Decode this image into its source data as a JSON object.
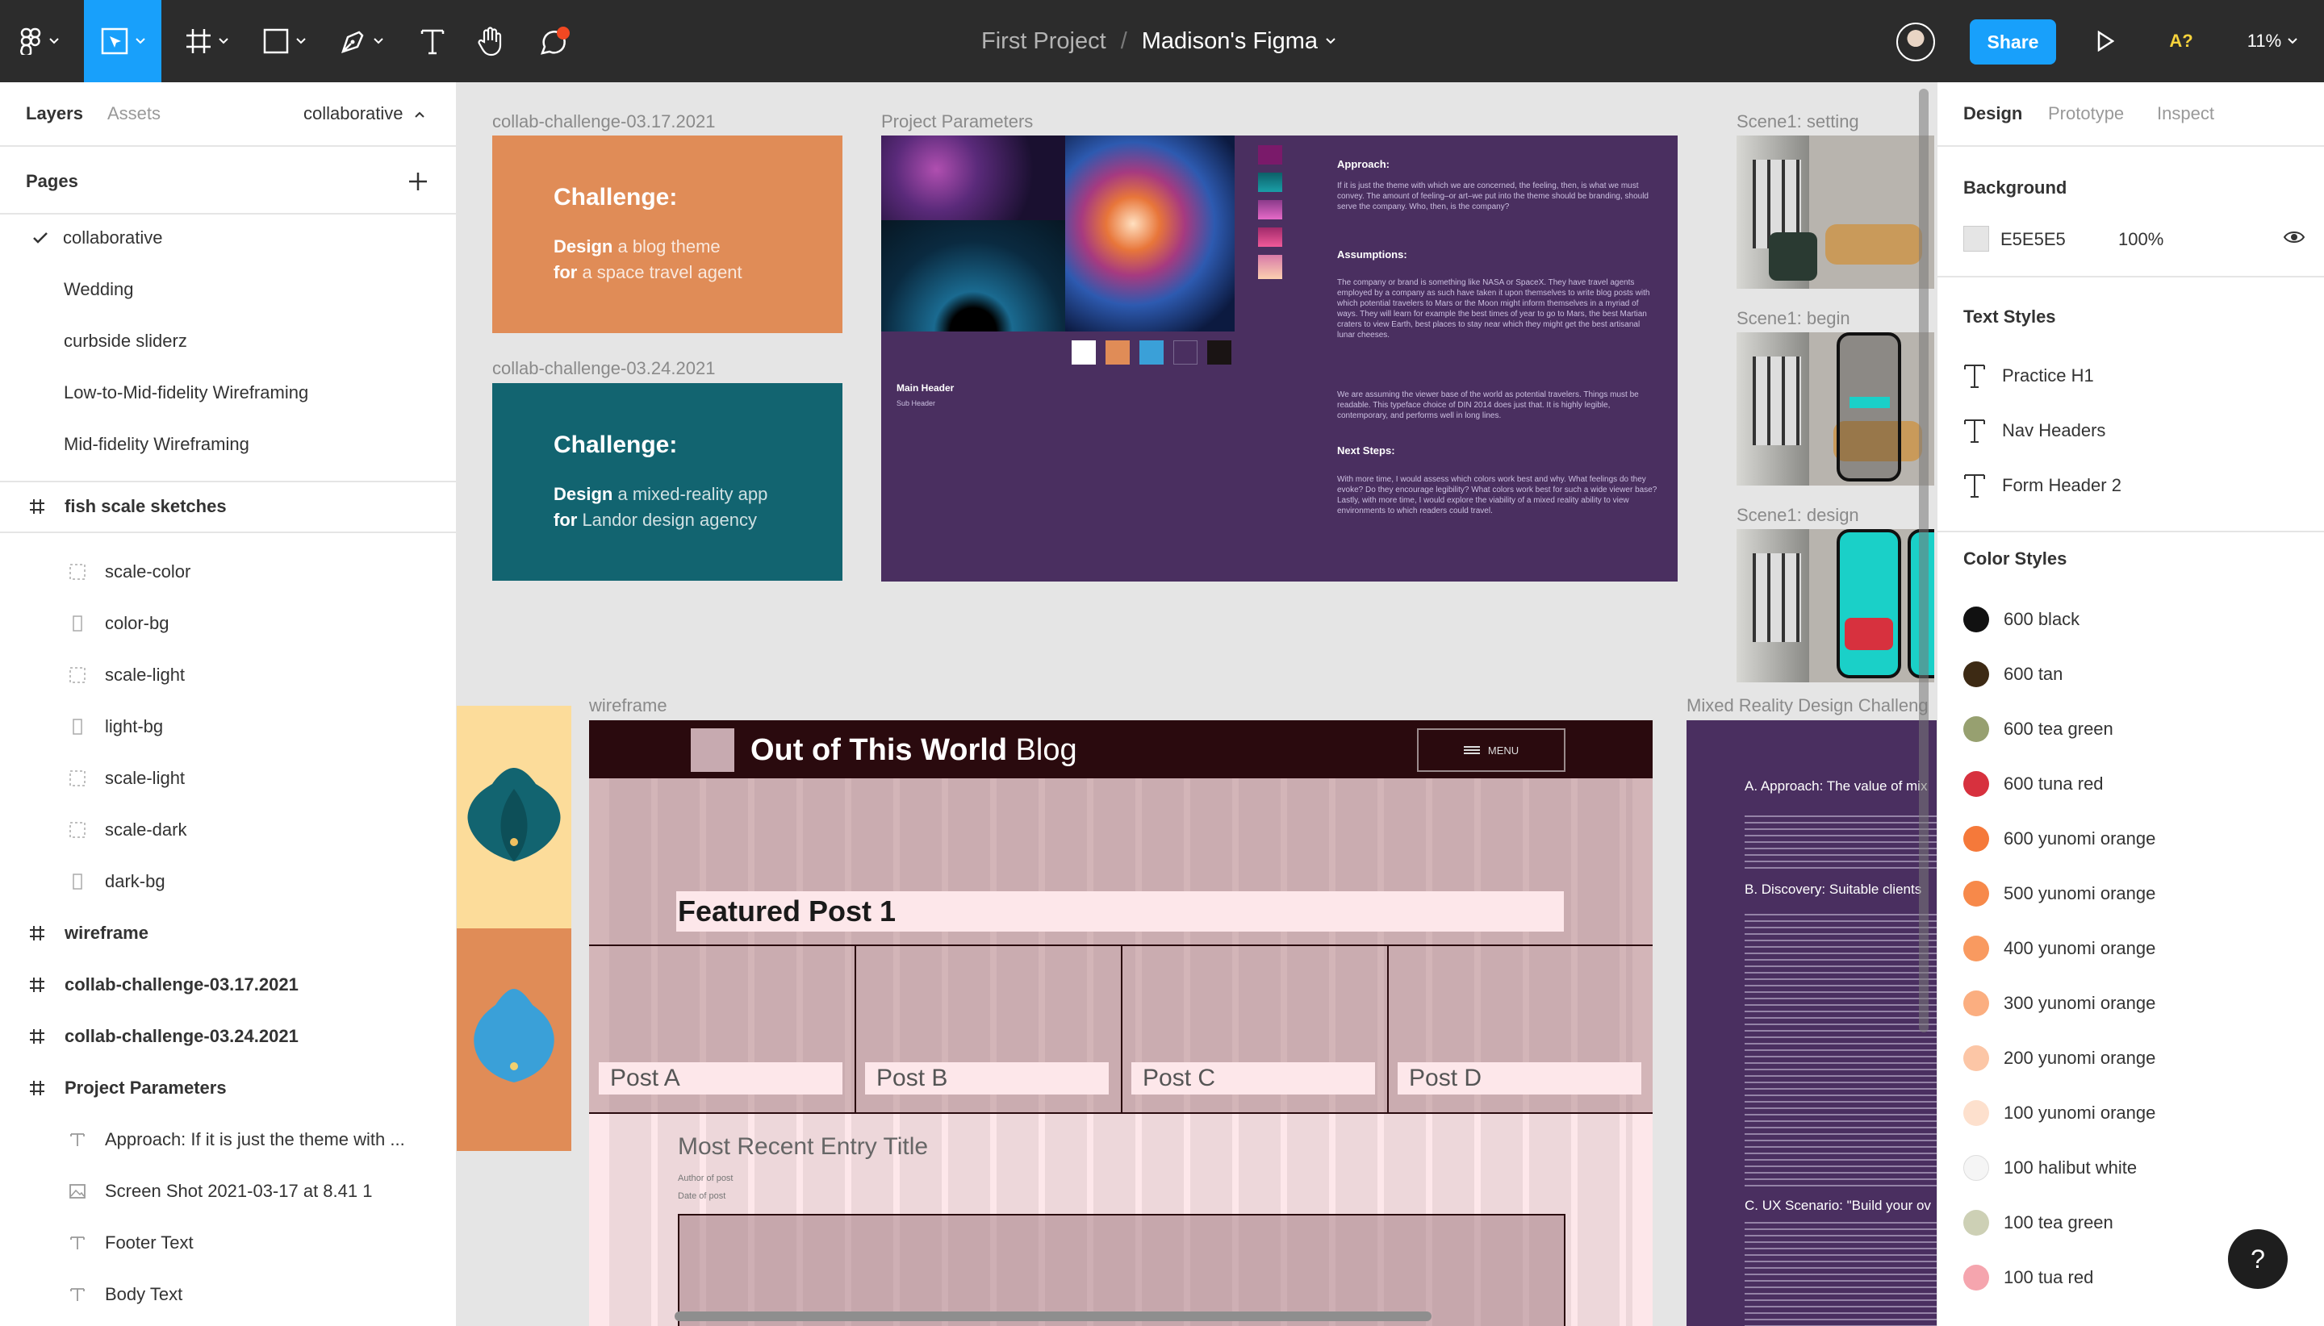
{
  "toolbar": {
    "project": "First Project",
    "separator": "/",
    "file_name": "Madison's Figma",
    "share_label": "Share",
    "user_initials": "A?",
    "zoom": "11%",
    "notification_color": "#f24822",
    "active_tool_color": "#18a0fb"
  },
  "left_panel": {
    "tabs": {
      "layers": "Layers",
      "assets": "Assets"
    },
    "current_page": "collaborative",
    "pages_title": "Pages",
    "pages": [
      {
        "label": "collaborative",
        "checked": true
      },
      {
        "label": "Wedding"
      },
      {
        "label": "curbside sliderz"
      },
      {
        "label": "Low-to-Mid-fidelity Wireframing"
      },
      {
        "label": "Mid-fidelity Wireframing"
      }
    ],
    "layers": [
      {
        "label": "fish scale sketches",
        "type": "frame",
        "bold": true
      },
      {
        "label": "scale-color",
        "type": "component"
      },
      {
        "label": "color-bg",
        "type": "rect"
      },
      {
        "label": "scale-light",
        "type": "component"
      },
      {
        "label": "light-bg",
        "type": "rect"
      },
      {
        "label": "scale-light",
        "type": "component"
      },
      {
        "label": "scale-dark",
        "type": "component"
      },
      {
        "label": "dark-bg",
        "type": "rect"
      },
      {
        "label": "wireframe",
        "type": "frame",
        "bold": true
      },
      {
        "label": "collab-challenge-03.17.2021",
        "type": "frame",
        "bold": true
      },
      {
        "label": "collab-challenge-03.24.2021",
        "type": "frame",
        "bold": true
      },
      {
        "label": "Project Parameters",
        "type": "frame",
        "bold": true
      },
      {
        "label": "Approach: If it is just the theme with ...",
        "type": "text"
      },
      {
        "label": "Screen Shot 2021-03-17 at 8.41 1",
        "type": "image"
      },
      {
        "label": "Footer Text",
        "type": "text"
      },
      {
        "label": "Body Text",
        "type": "text"
      }
    ]
  },
  "right_panel": {
    "tabs": {
      "design": "Design",
      "prototype": "Prototype",
      "inspect": "Inspect"
    },
    "background_title": "Background",
    "background_hex": "E5E5E5",
    "background_opacity": "100%",
    "text_styles_title": "Text Styles",
    "text_styles": [
      "Practice H1",
      "Nav Headers",
      "Form Header 2"
    ],
    "color_styles_title": "Color Styles",
    "color_styles": [
      {
        "name": "600 black",
        "color": "#111111"
      },
      {
        "name": "600 tan",
        "color": "#3d2a14"
      },
      {
        "name": "600 tea green",
        "color": "#97a070"
      },
      {
        "name": "600 tuna red",
        "color": "#d7313e"
      },
      {
        "name": "600 yunomi orange",
        "color": "#f5793a"
      },
      {
        "name": "500 yunomi orange",
        "color": "#f7894a"
      },
      {
        "name": "400 yunomi orange",
        "color": "#f99a60"
      },
      {
        "name": "300 yunomi orange",
        "color": "#fbae80"
      },
      {
        "name": "200 yunomi orange",
        "color": "#fcc6a6"
      },
      {
        "name": "100 yunomi orange",
        "color": "#fde0cd"
      },
      {
        "name": "100 halibut white",
        "color": "#f5f5f5"
      },
      {
        "name": "100 tea green",
        "color": "#cdd0b5"
      },
      {
        "name": "100 tua red",
        "color": "#f5a5ae"
      }
    ],
    "help": "?"
  },
  "canvas": {
    "frames": {
      "challenge1": "collab-challenge-03.17.2021",
      "challenge2": "collab-challenge-03.24.2021",
      "params": "Project Parameters",
      "scene_setting": "Scene1: setting",
      "scene_begin": "Scene1: begin",
      "scene_design": "Scene1: design",
      "wireframe": "wireframe",
      "mixed_reality": "Mixed Reality Design Challeng"
    },
    "challenge1": {
      "heading": "Challenge:",
      "design_word": "Design",
      "design_text": " a blog theme",
      "for_word": "for",
      "for_text": " a space travel agent",
      "color": "#e08c57"
    },
    "challenge2": {
      "heading": "Challenge:",
      "design_word": "Design",
      "design_text": " a mixed-reality app",
      "for_word": "for",
      "for_text": " Landor design agency",
      "color": "#126470"
    },
    "params": {
      "approach_title": "Approach:",
      "approach_text": "If it is just the theme with which we are concerned, the feeling, then, is what we must convey. The amount of feeling–or art–we put into the theme should be branding, should serve the company. Who, then, is the company?",
      "assumptions_title": "Assumptions:",
      "assumptions_text": "The company or brand is something like NASA or SpaceX. They have travel agents employed by a company as such have taken it upon themselves to write blog posts with which potential travelers to Mars or the Moon might inform themselves in a myriad of ways. They will learn for example the best times of year to go to Mars, the best Martian craters to view Earth, best places to stay near which they might get the best artisanal lunar cheeses.",
      "assumptions_text2": "We are assuming the viewer base of the world as potential travelers. Things must be readable. This typeface choice of DIN 2014 does just that. It is highly legible, contemporary, and performs well in long lines.",
      "next_title": "Next Steps:",
      "next_text": "With more time, I would assess which colors work best and why. What feelings do they evoke? Do they encourage legibility? What colors work best for such a wide viewer base? Lastly, with more time, I would explore the viability of a mixed reality ability to view environments to which readers could travel.",
      "main_header": "Main Header",
      "sub_header": "Sub Header",
      "bg_color": "#4a2f60"
    },
    "wireframe": {
      "blog_title_bold": "Out of This World",
      "blog_title_light": " Blog",
      "menu": "MENU",
      "featured": "Featured Post 1",
      "posts": [
        "Post A",
        "Post B",
        "Post C",
        "Post D"
      ],
      "recent_title": "Most Recent Entry Title",
      "author": "Author of post",
      "date": "Date of post"
    },
    "mixed_reality": {
      "heading_a": "A. Approach: The value of mix",
      "heading_b": "B. Discovery: Suitable clients",
      "heading_c": "C. UX Scenario: \"Build your ov"
    }
  }
}
